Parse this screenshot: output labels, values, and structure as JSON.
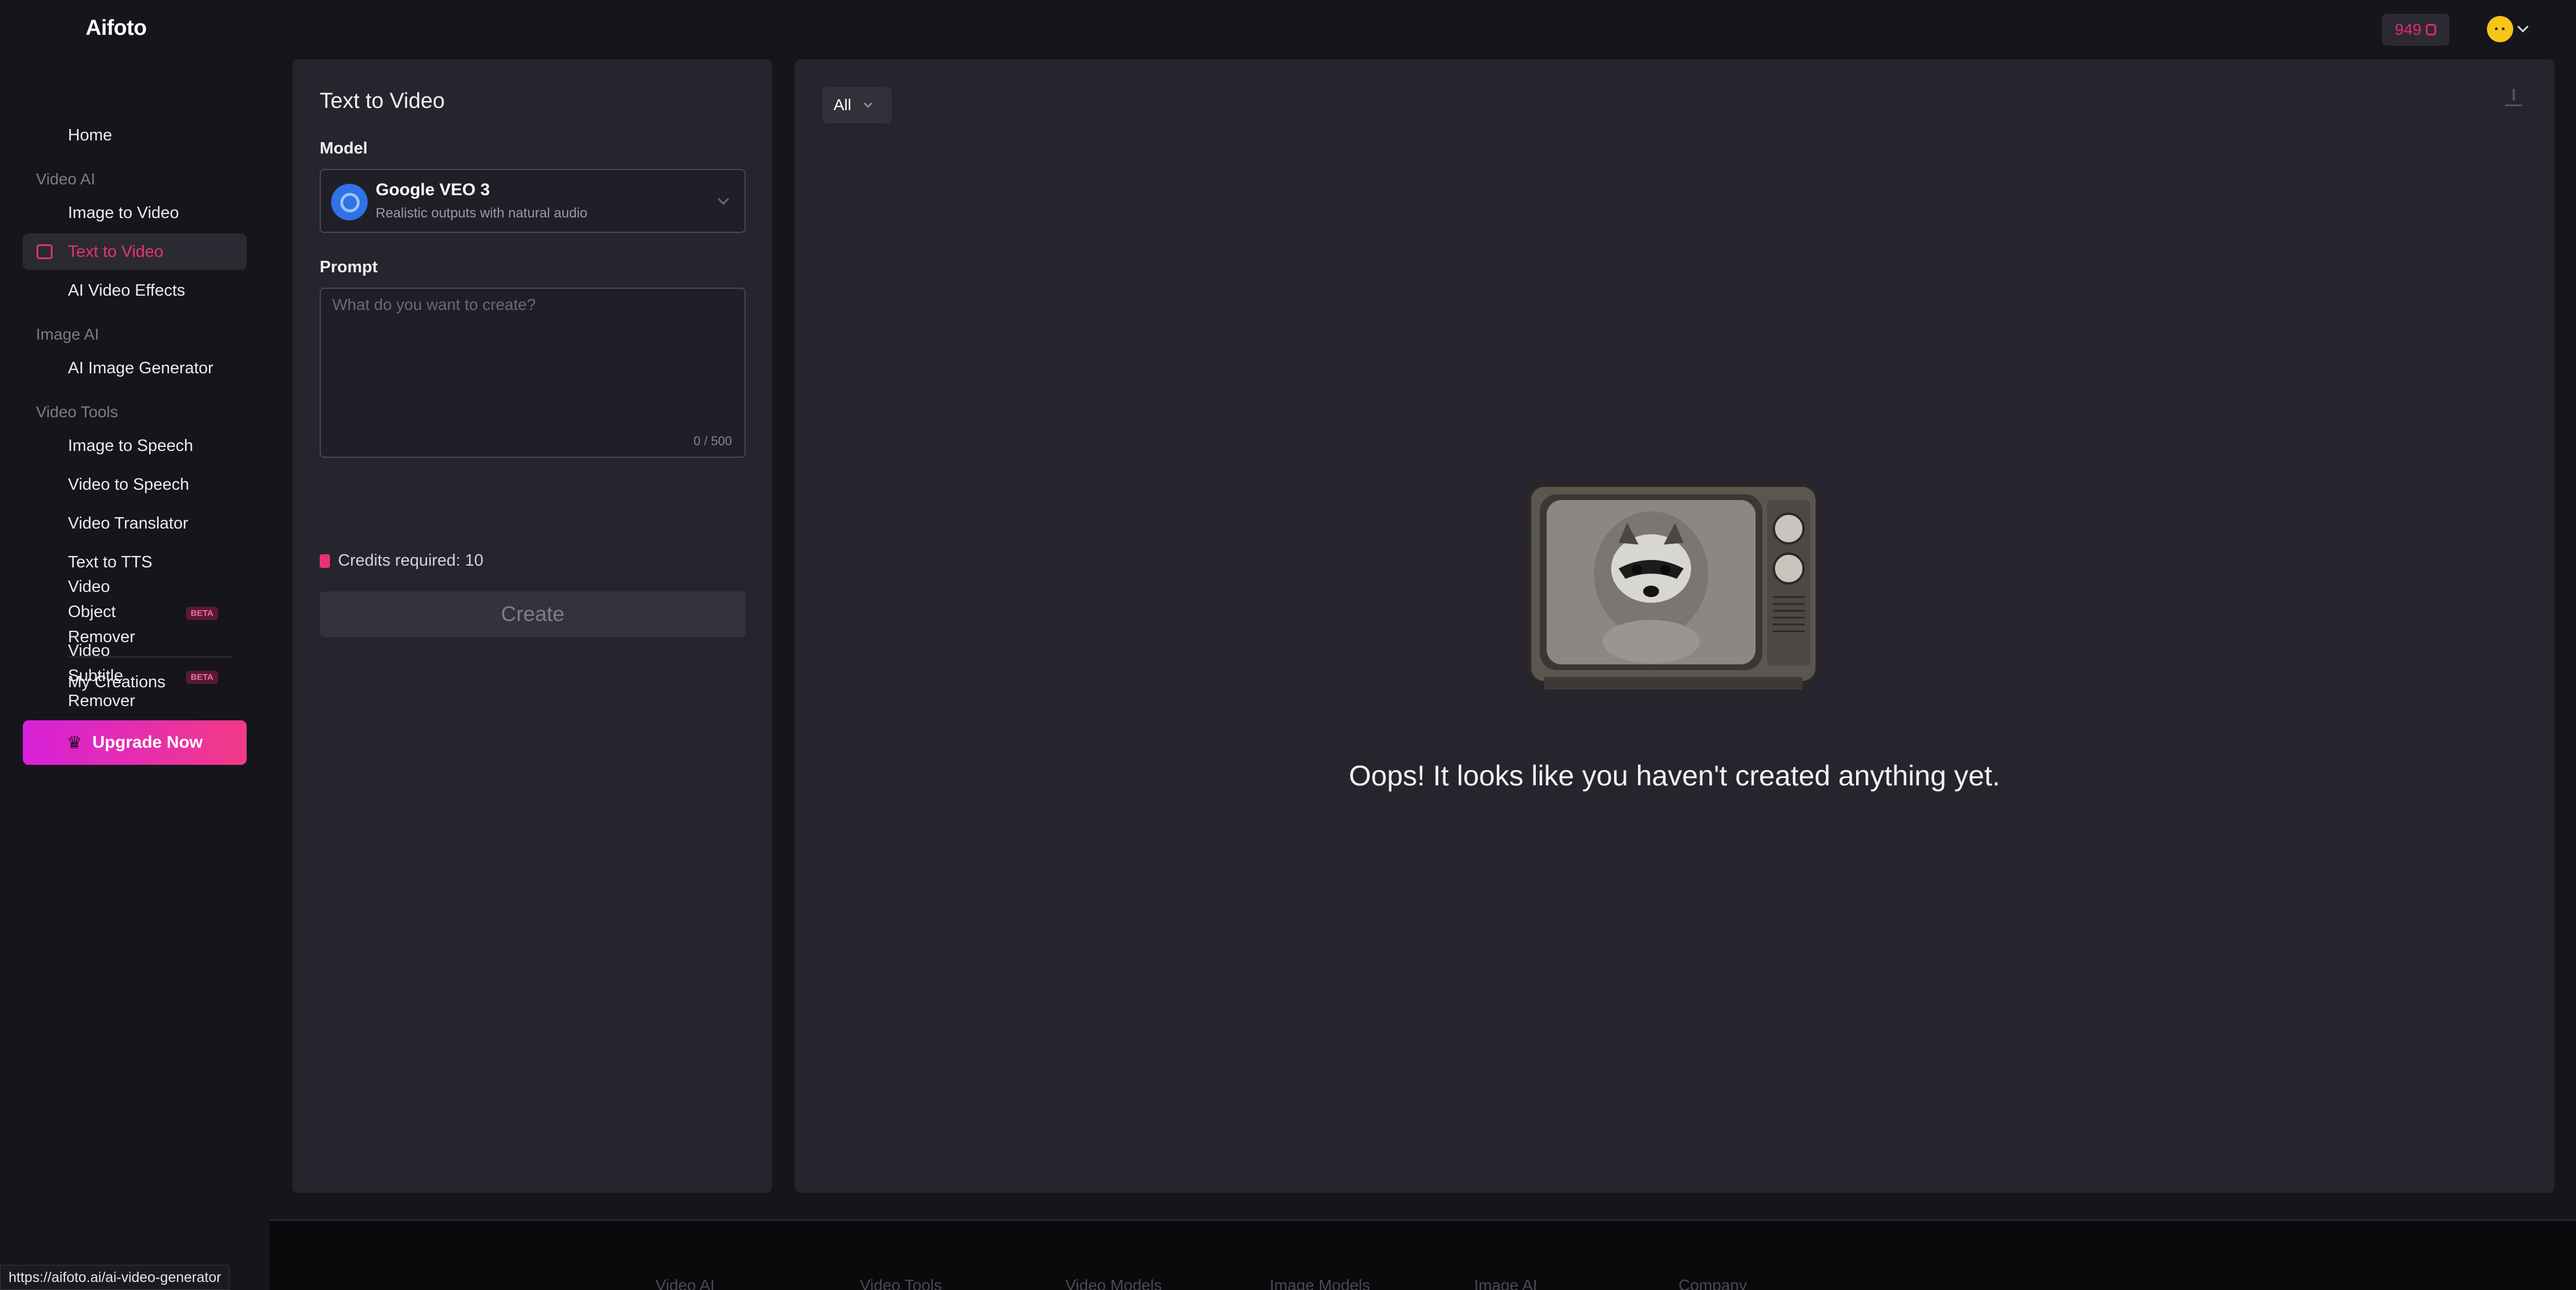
{
  "app": {
    "logo": "Aifoto",
    "credits": "949"
  },
  "sidebar": {
    "home": "Home",
    "group_video_ai": "Video AI",
    "image_to_video": "Image to Video",
    "text_to_video": "Text to Video",
    "ai_video_effects": "AI Video Effects",
    "group_image_ai": "Image AI",
    "ai_image_generator": "AI Image Generator",
    "group_video_tools": "Video Tools",
    "image_to_speech": "Image to Speech",
    "video_to_speech": "Video to Speech",
    "video_translator": "Video Translator",
    "text_to_tts": "Text to TTS",
    "video_object_remover": "Video Object Remover",
    "video_subtitle_remover": "Video Subtitle Remover",
    "beta": "BETA",
    "my_creations": "My Creations",
    "upgrade": "Upgrade Now"
  },
  "form": {
    "title": "Text to Video",
    "model_label": "Model",
    "model_name": "Google VEO 3",
    "model_desc": "Realistic outputs with natural audio",
    "prompt_label": "Prompt",
    "prompt_placeholder": "What do you want to create?",
    "prompt_value": "",
    "counter": "0 / 500",
    "credits_required": "Credits required: 10",
    "create": "Create"
  },
  "gallery": {
    "filter": "All",
    "empty_message": "Oops! It looks like you haven't created anything yet."
  },
  "footer": {
    "links": [
      "Video AI",
      "Video Tools",
      "Video Models",
      "Image Models",
      "Image AI",
      "Company"
    ]
  },
  "status_url": "https://aifoto.ai/ai-video-generator",
  "colors": {
    "accent": "#e5346f",
    "upgrade_start": "#d721d9",
    "upgrade_end": "#f23a86",
    "panel": "#26252e",
    "bg": "#16151c"
  }
}
